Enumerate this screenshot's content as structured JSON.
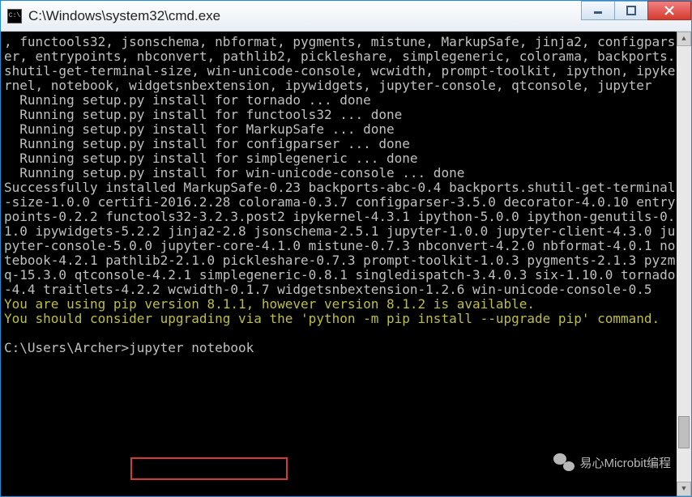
{
  "window": {
    "title": "C:\\Windows\\system32\\cmd.exe"
  },
  "terminal": {
    "lines": [
      ", functools32, jsonschema, nbformat, pygments, mistune, MarkupSafe, jinja2, configparser, entrypoints, nbconvert, pathlib2, pickleshare, simplegeneric, colorama, backports.shutil-get-terminal-size, win-unicode-console, wcwidth, prompt-toolkit, ipython, ipykernel, notebook, widgetsnbextension, ipywidgets, jupyter-console, qtconsole, jupyter",
      "  Running setup.py install for tornado ... done",
      "  Running setup.py install for functools32 ... done",
      "  Running setup.py install for MarkupSafe ... done",
      "  Running setup.py install for configparser ... done",
      "  Running setup.py install for simplegeneric ... done",
      "  Running setup.py install for win-unicode-console ... done",
      "Successfully installed MarkupSafe-0.23 backports-abc-0.4 backports.shutil-get-terminal-size-1.0.0 certifi-2016.2.28 colorama-0.3.7 configparser-3.5.0 decorator-4.0.10 entrypoints-0.2.2 functools32-3.2.3.post2 ipykernel-4.3.1 ipython-5.0.0 ipython-genutils-0.1.0 ipywidgets-5.2.2 jinja2-2.8 jsonschema-2.5.1 jupyter-1.0.0 jupyter-client-4.3.0 jupyter-console-5.0.0 jupyter-core-4.1.0 mistune-0.7.3 nbconvert-4.2.0 nbformat-4.0.1 notebook-4.2.1 pathlib2-2.1.0 pickleshare-0.7.3 prompt-toolkit-1.0.3 pygments-2.1.3 pyzmq-15.3.0 qtconsole-4.2.1 simplegeneric-0.8.1 singledispatch-3.4.0.3 six-1.10.0 tornado-4.4 traitlets-4.2.2 wcwidth-0.1.7 widgetsnbextension-1.2.6 win-unicode-console-0.5"
    ],
    "warning": [
      "You are using pip version 8.1.1, however version 8.1.2 is available.",
      "You should consider upgrading via the 'python -m pip install --upgrade pip' command."
    ],
    "prompt_prefix": "C:\\Users\\Archer>",
    "prompt_command": "jupyter notebook"
  },
  "watermark": {
    "text": "易心Microbit编程"
  }
}
